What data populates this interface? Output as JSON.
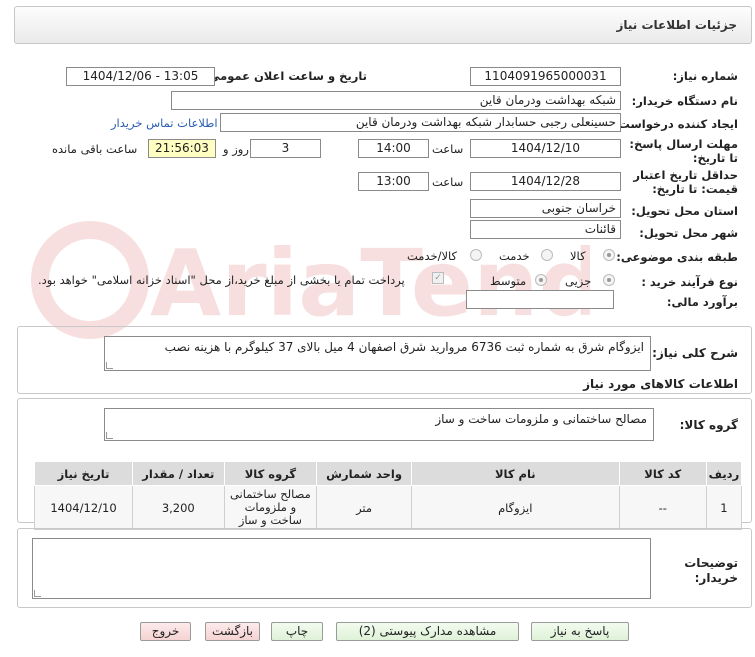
{
  "header": {
    "title": "جزئیات اطلاعات نیاز"
  },
  "labels": {
    "need_number": "شماره نیاز:",
    "announce_datetime": "تاریخ و ساعت اعلان عمومی:",
    "buyer_org": "نام دستگاه خریدار:",
    "requester": "ایجاد کننده درخواست:",
    "reply_deadline": "مهلت ارسال پاسخ: تا تاریخ:",
    "min_price_validity": "حداقل تاریخ اعتبار قیمت: تا تاریخ:",
    "time_label": "ساعت",
    "day_label": "روز و",
    "remaining": "ساعت باقی مانده",
    "province": "استان محل تحویل:",
    "city": "شهر محل تحویل:",
    "category": "طبقه بندی موضوعی:",
    "purchase_type": "نوع فرآیند خرید :",
    "budget": "برآورد مالی:",
    "general_desc": "شرح کلی نیاز:",
    "goods_info_title": "اطلاعات کالاهای مورد نیاز",
    "goods_group": "گروه کالا:",
    "buyer_notes": "توضیحات خریدار:"
  },
  "values": {
    "need_number": "1104091965000031",
    "announce_datetime": "1404/12/06 - 13:05",
    "buyer_org": "شبکه بهداشت ودرمان قاین",
    "requester": "حسینعلی رجبی حسابدار شبکه بهداشت ودرمان قاین",
    "contact_link": "اطلاعات تماس خریدار",
    "reply_date": "1404/12/10",
    "reply_time": "14:00",
    "days_left": "3",
    "time_left": "21:56:03",
    "validity_date": "1404/12/28",
    "validity_time": "13:00",
    "province": "خراسان جنوبی",
    "city": "قائنات",
    "budget": "",
    "general_desc": "ایزوگام شرق به شماره ثبت 6736 مروارید شرق اصفهان 4 میل بالای 37 کیلوگرم با هزینه نصب",
    "goods_group": "مصالح ساختمانی و ملزومات ساخت و ساز",
    "buyer_notes": ""
  },
  "category_options": {
    "goods": "کالا",
    "service": "خدمت",
    "goods_service": "کالا/خدمت",
    "selected": "کالا"
  },
  "purchase_options": {
    "partial": "جزیی",
    "medium": "متوسط",
    "selected": "جزیی"
  },
  "treasury_note": "پرداخت تمام یا بخشی از مبلغ خرید،از محل \"اسناد خزانه اسلامی\" خواهد بود.",
  "table": {
    "headers": [
      "ردیف",
      "کد کالا",
      "نام کالا",
      "واحد شمارش",
      "گروه کالا",
      "تعداد / مقدار",
      "تاریخ نیاز"
    ],
    "rows": [
      {
        "row": "1",
        "code": "--",
        "name": "ایزوگام",
        "unit": "متر",
        "group": "مصالح ساختمانی و ملزومات ساخت و ساز",
        "qty": "3,200",
        "date": "1404/12/10"
      }
    ]
  },
  "buttons": {
    "reply": "پاسخ به نیاز",
    "attachments": "مشاهده مدارک پیوستی (2)",
    "print": "چاپ",
    "back": "بازگشت",
    "exit": "خروج"
  },
  "watermark": "AriaTender.net"
}
